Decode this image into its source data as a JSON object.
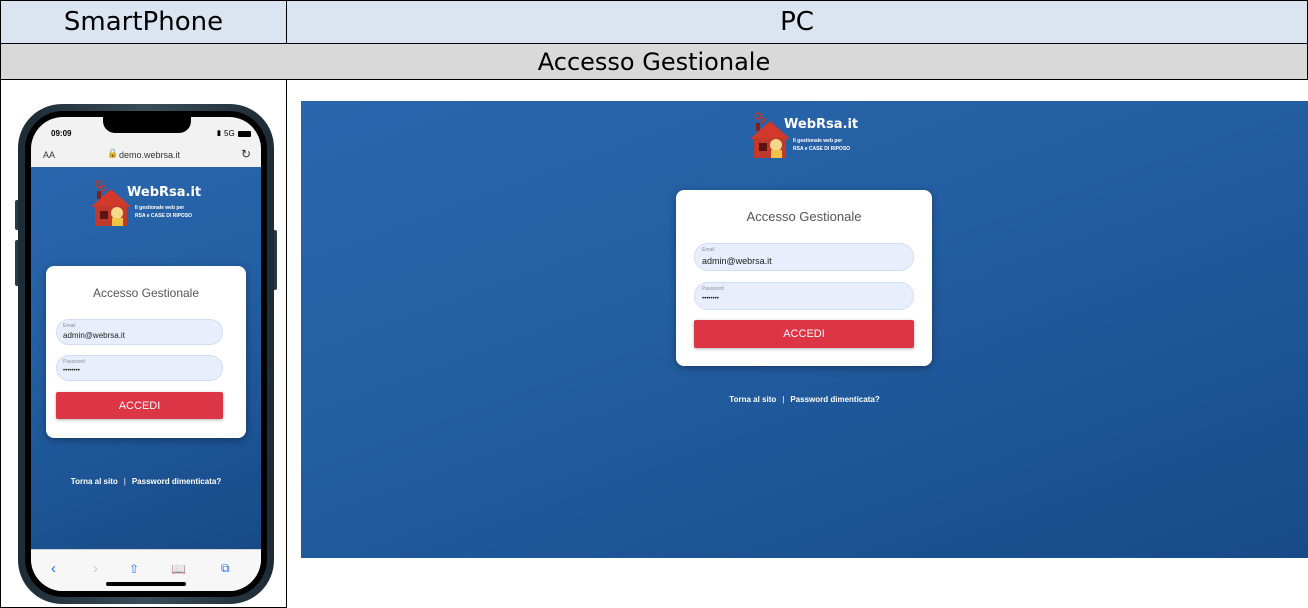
{
  "table": {
    "col1_header": "SmartPhone",
    "col2_header": "PC",
    "section_header": "Accesso Gestionale"
  },
  "phone": {
    "time": "09:09",
    "signal": "5G",
    "text_size": "AA",
    "url": "demo.webrsa.it",
    "reload_icon": "reload-icon",
    "toolbar_icons": [
      "back-icon",
      "forward-icon",
      "share-icon",
      "bookmarks-icon",
      "tabs-icon"
    ]
  },
  "app": {
    "brand": "WebRsa.it",
    "tagline_line1": "Il gestionale web per",
    "tagline_line2": "RSA e CASE DI RIPOSO",
    "login_title": "Accesso Gestionale",
    "email_label": "Email",
    "email_value": "admin@webrsa.it",
    "password_label": "Password",
    "password_value": "••••••••",
    "submit_label": "ACCEDI",
    "link_back": "Torna al sito",
    "link_separator": "|",
    "link_forgot": "Password dimenticata?"
  },
  "colors": {
    "background_blue": "#245fa3",
    "accent_red": "#dc3545",
    "header_blue": "#dbe5f1",
    "header_gray": "#d9d9d9"
  }
}
